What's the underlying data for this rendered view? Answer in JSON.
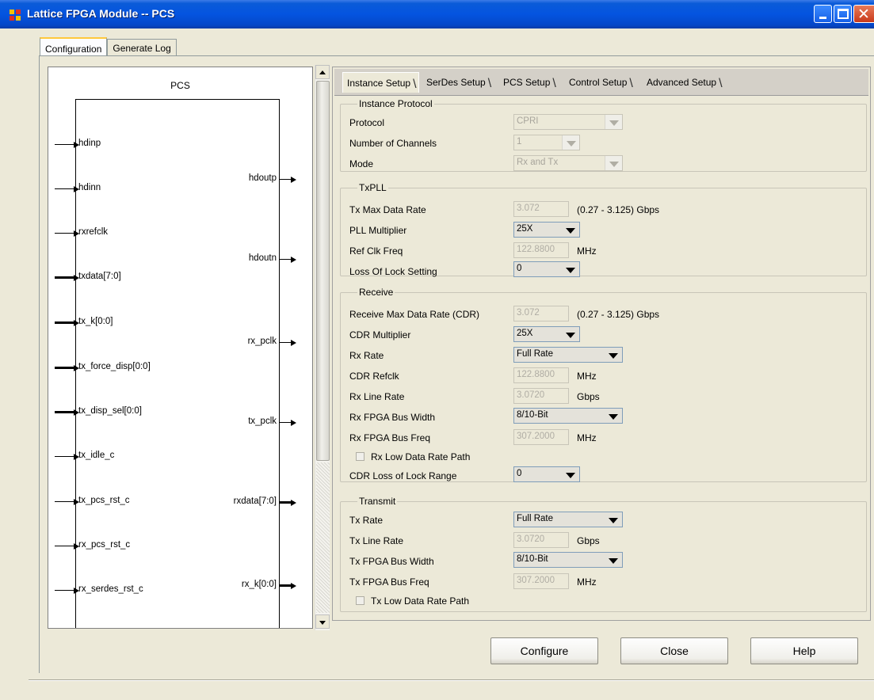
{
  "window": {
    "title": "Lattice FPGA Module -- PCS",
    "controls": {
      "minimize_icon": "minimize-icon",
      "maximize_icon": "maximize-icon",
      "close_icon": "close-icon"
    }
  },
  "outer_tabs": [
    {
      "label": "Configuration",
      "active": true
    },
    {
      "label": "Generate Log",
      "active": false
    }
  ],
  "diagram": {
    "title": "PCS",
    "inputs": [
      {
        "label": "hdinp",
        "bus": false
      },
      {
        "label": "hdinn",
        "bus": false
      },
      {
        "label": "rxrefclk",
        "bus": false
      },
      {
        "label": "txdata[7:0]",
        "bus": true
      },
      {
        "label": "tx_k[0:0]",
        "bus": true
      },
      {
        "label": "tx_force_disp[0:0]",
        "bus": true
      },
      {
        "label": "tx_disp_sel[0:0]",
        "bus": true
      },
      {
        "label": "tx_idle_c",
        "bus": false
      },
      {
        "label": "tx_pcs_rst_c",
        "bus": false
      },
      {
        "label": "rx_pcs_rst_c",
        "bus": false
      },
      {
        "label": "rx_serdes_rst_c",
        "bus": false
      }
    ],
    "outputs": [
      {
        "label": "hdoutp",
        "bus": false
      },
      {
        "label": "hdoutn",
        "bus": false
      },
      {
        "label": "rx_pclk",
        "bus": false
      },
      {
        "label": "tx_pclk",
        "bus": false
      },
      {
        "label": "rxdata[7:0]",
        "bus": true
      },
      {
        "label": "rx_k[0:0]",
        "bus": true
      }
    ]
  },
  "inner_tabs": [
    {
      "label": "Instance Setup",
      "active": true
    },
    {
      "label": "SerDes Setup",
      "active": false
    },
    {
      "label": "PCS Setup",
      "active": false
    },
    {
      "label": "Control Setup",
      "active": false
    },
    {
      "label": "Advanced Setup",
      "active": false
    }
  ],
  "instance_protocol": {
    "title": "Instance Protocol",
    "protocol": {
      "label": "Protocol",
      "value": "CPRI"
    },
    "num_channels": {
      "label": "Number of Channels",
      "value": "1"
    },
    "mode": {
      "label": "Mode",
      "value": "Rx and Tx"
    }
  },
  "txpll": {
    "title": "TxPLL",
    "tx_max_rate": {
      "label": "Tx Max Data Rate",
      "value": "3.072",
      "unit": "(0.27 - 3.125) Gbps"
    },
    "pll_mult": {
      "label": "PLL Multiplier",
      "value": "25X"
    },
    "ref_clk": {
      "label": "Ref Clk Freq",
      "value": "122.8800",
      "unit": "MHz"
    },
    "lol": {
      "label": "Loss Of Lock Setting",
      "value": "0"
    }
  },
  "receive": {
    "title": "Receive",
    "rx_max_rate": {
      "label": "Receive Max Data Rate (CDR)",
      "value": "3.072",
      "unit": "(0.27 - 3.125) Gbps"
    },
    "cdr_mult": {
      "label": "CDR Multiplier",
      "value": "25X"
    },
    "rx_rate": {
      "label": "Rx Rate",
      "value": "Full Rate"
    },
    "cdr_refclk": {
      "label": "CDR Refclk",
      "value": "122.8800",
      "unit": "MHz"
    },
    "rx_line_rate": {
      "label": "Rx Line Rate",
      "value": "3.0720",
      "unit": "Gbps"
    },
    "rx_bus_width": {
      "label": "Rx FPGA Bus Width",
      "value": "8/10-Bit"
    },
    "rx_bus_freq": {
      "label": "Rx FPGA Bus Freq",
      "value": "307.2000",
      "unit": "MHz"
    },
    "rx_low_rate": {
      "label": "Rx Low Data Rate Path",
      "checked": false
    },
    "cdr_lol": {
      "label": "CDR Loss of Lock Range",
      "value": "0"
    }
  },
  "transmit": {
    "title": "Transmit",
    "tx_rate": {
      "label": "Tx Rate",
      "value": "Full Rate"
    },
    "tx_line_rate": {
      "label": "Tx Line Rate",
      "value": "3.0720",
      "unit": "Gbps"
    },
    "tx_bus_width": {
      "label": "Tx FPGA Bus Width",
      "value": "8/10-Bit"
    },
    "tx_bus_freq": {
      "label": "Tx FPGA Bus Freq",
      "value": "307.2000",
      "unit": "MHz"
    },
    "tx_low_rate": {
      "label": "Tx Low Data Rate Path",
      "checked": false
    }
  },
  "buttons": {
    "configure": "Configure",
    "close": "Close",
    "help": "Help"
  }
}
